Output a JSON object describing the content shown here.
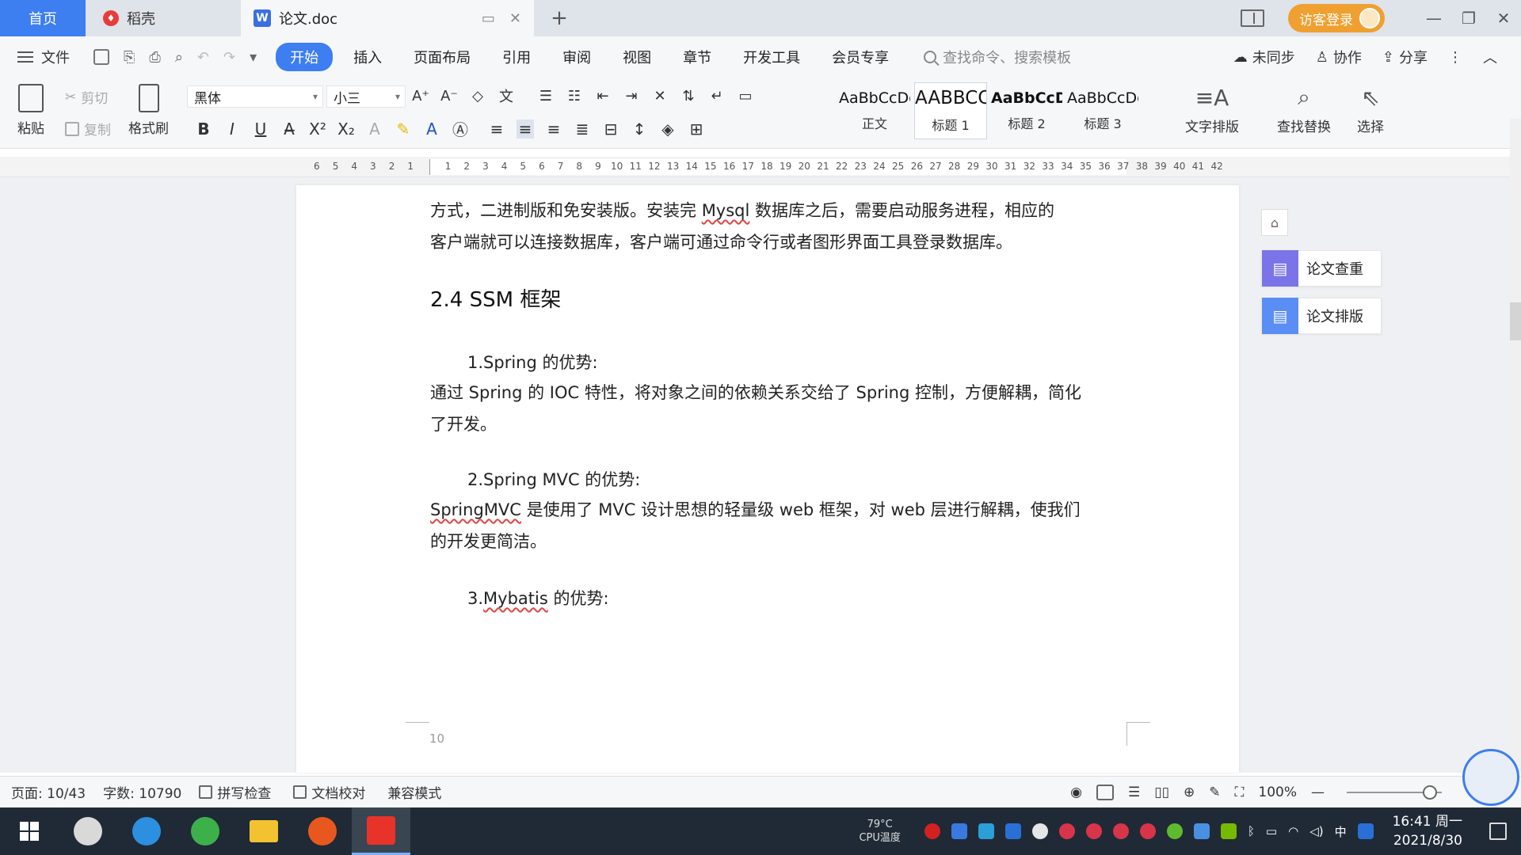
{
  "tabs": {
    "home": "首页",
    "daoke": "稻壳",
    "doc": "论文.doc"
  },
  "login": "访客登录",
  "menu": {
    "file": "文件",
    "items": [
      "开始",
      "插入",
      "页面布局",
      "引用",
      "审阅",
      "视图",
      "章节",
      "开发工具",
      "会员专享"
    ],
    "search_placeholder": "查找命令、搜索模板",
    "sync": "未同步",
    "collab": "协作",
    "share": "分享"
  },
  "ribbon": {
    "paste": "粘贴",
    "cut": "剪切",
    "copy": "复制",
    "format_painter": "格式刷",
    "font": "黑体",
    "size": "小三",
    "styles": [
      {
        "sample": "AaBbCcDd",
        "name": "正文"
      },
      {
        "sample": "AABBCC",
        "name": "标题 1"
      },
      {
        "sample": "AaBbCcD",
        "name": "标题 2"
      },
      {
        "sample": "AaBbCcDc",
        "name": "标题 3"
      }
    ],
    "text_layout": "文字排版",
    "find_replace": "查找替换",
    "select": "选择"
  },
  "ruler": [
    "6",
    "5",
    "4",
    "3",
    "2",
    "1",
    "",
    "1",
    "2",
    "3",
    "4",
    "5",
    "6",
    "7",
    "8",
    "9",
    "10",
    "11",
    "12",
    "13",
    "14",
    "15",
    "16",
    "17",
    "18",
    "19",
    "20",
    "21",
    "22",
    "23",
    "24",
    "25",
    "26",
    "27",
    "28",
    "29",
    "30",
    "31",
    "32",
    "33",
    "34",
    "35",
    "36",
    "37",
    "38",
    "39",
    "40",
    "41",
    "42"
  ],
  "document": {
    "para1_line1_a": "方式，二进制版和免安装版。安装完 ",
    "para1_line1_mysql": "Mysql",
    "para1_line1_b": " 数据库之后，需要启动服务进程，相应的",
    "para1_line2": "客户端就可以连接数据库，客户端可通过命令行或者图形界面工具登录数据库。",
    "heading": "2.4  SSM 框架",
    "sub1": "1.Spring 的优势:",
    "body1_line1": "通过 Spring 的 IOC 特性，将对象之间的依赖关系交给了 Spring 控制，方便解耦，简化",
    "body1_line2": "了开发。",
    "sub2": "2.Spring MVC 的优势:",
    "body2_springmvc": "SpringMVC",
    "body2_line1": " 是使用了 MVC 设计思想的轻量级 web 框架，对 web 层进行解耦，使我们",
    "body2_line2": "的开发更简洁。",
    "sub3_prefix": "3.",
    "sub3_mybatis": "Mybatis",
    "sub3_suffix": " 的优势:",
    "page_number": "10"
  },
  "side_panel": {
    "check": "论文查重",
    "layout": "论文排版"
  },
  "status": {
    "page": "页面: 10/43",
    "words": "字数: 10790",
    "spell": "拼写检查",
    "proof": "文档校对",
    "compat": "兼容模式",
    "zoom": "100%"
  },
  "taskbar": {
    "cpu_temp": "79°C",
    "cpu_label": "CPU温度",
    "ime": "中",
    "time": "16:41 周一",
    "date": "2021/8/30"
  }
}
